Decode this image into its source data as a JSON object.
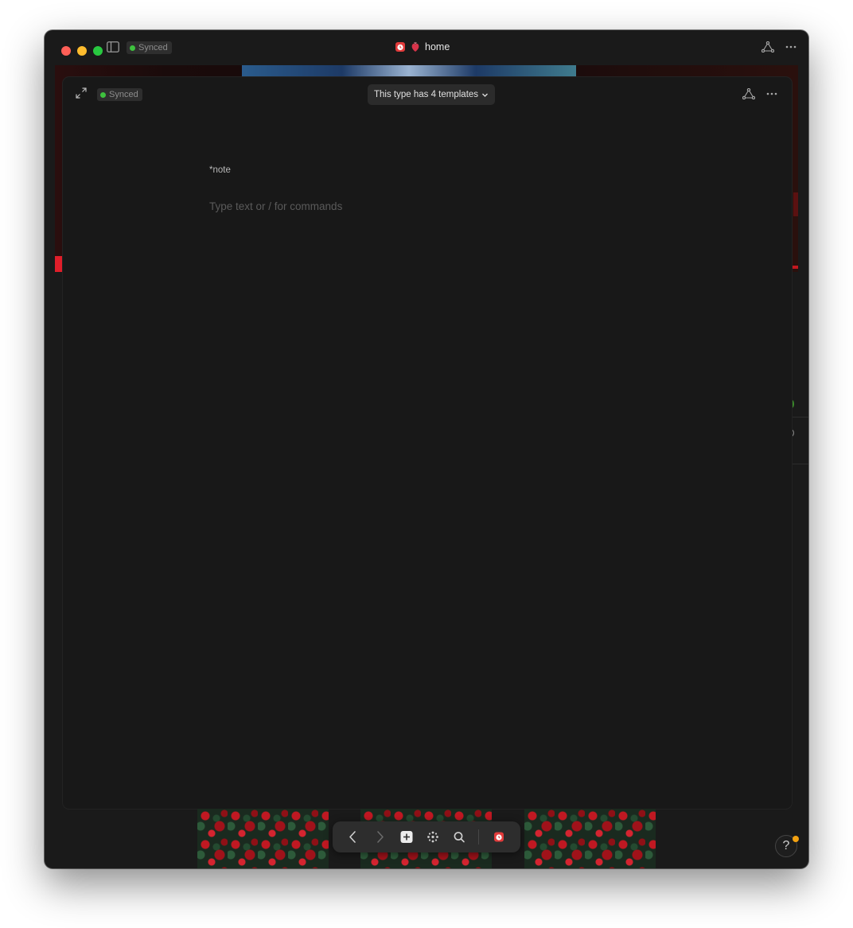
{
  "titlebar": {
    "sync_status": "Synced",
    "page_title": "home"
  },
  "editor_header": {
    "sync_status": "Synced",
    "templates_button": "This type has 4 templates"
  },
  "editor": {
    "object_type": "*note",
    "placeholder": "Type text or / for commands"
  },
  "nav_bar": {
    "items": [
      "back-arrow-icon",
      "forward-arrow-icon",
      "plus-icon",
      "graph-dots-icon",
      "search-icon",
      "space-icon"
    ]
  },
  "help": {
    "label": "?"
  },
  "colors": {
    "accent_sync": "#3ec13e",
    "help_badge": "#f2a111",
    "background": "#181818"
  }
}
